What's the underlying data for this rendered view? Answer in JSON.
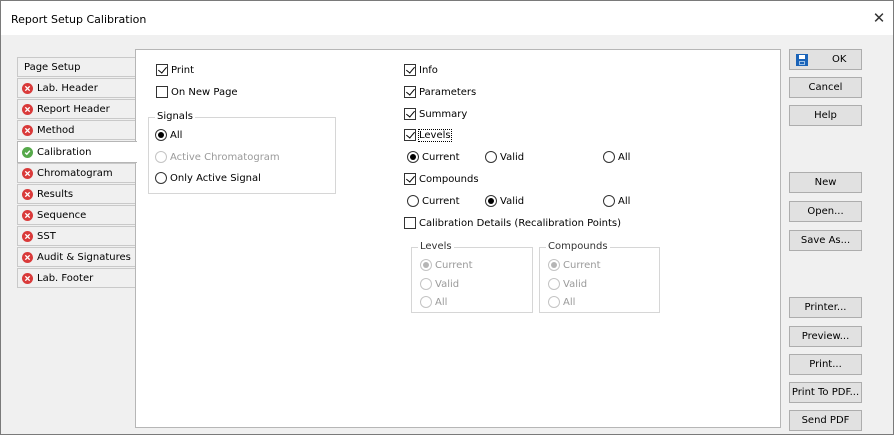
{
  "window": {
    "title": "Report Setup Calibration",
    "close_glyph": "✕"
  },
  "tabs": [
    {
      "label": "Page Setup",
      "icon": "none"
    },
    {
      "label": "Lab. Header",
      "icon": "error-icon"
    },
    {
      "label": "Report Header",
      "icon": "error-icon"
    },
    {
      "label": "Method",
      "icon": "error-icon"
    },
    {
      "label": "Calibration",
      "icon": "check-icon",
      "active": true
    },
    {
      "label": "Chromatogram",
      "icon": "error-icon"
    },
    {
      "label": "Results",
      "icon": "error-icon"
    },
    {
      "label": "Sequence",
      "icon": "error-icon"
    },
    {
      "label": "SST",
      "icon": "error-icon"
    },
    {
      "label": "Audit & Signatures",
      "icon": "error-icon"
    },
    {
      "label": "Lab. Footer",
      "icon": "error-icon"
    }
  ],
  "left": {
    "print": {
      "label": "Print",
      "checked": true
    },
    "on_new_page": {
      "label": "On New Page",
      "checked": false
    },
    "signals": {
      "label": "Signals",
      "all": "All",
      "active_chromatogram": "Active Chromatogram",
      "only_active_signal": "Only Active Signal",
      "selected": "All"
    }
  },
  "right": {
    "info": {
      "label": "Info",
      "checked": true
    },
    "parameters": {
      "label": "Parameters",
      "checked": true
    },
    "summary": {
      "label": "Summary",
      "checked": true
    },
    "levels": {
      "label": "Levels",
      "checked": true
    },
    "levels_options": {
      "current": "Current",
      "valid": "Valid",
      "all": "All",
      "selected": "Current"
    },
    "compounds": {
      "label": "Compounds",
      "checked": true
    },
    "compounds_options": {
      "current": "Current",
      "valid": "Valid",
      "all": "All",
      "selected": "Valid"
    },
    "calibration_details": {
      "label": "Calibration Details (Recalibration Points)",
      "checked": false
    },
    "details_levels": {
      "label": "Levels",
      "current": "Current",
      "valid": "Valid",
      "all": "All",
      "selected": "Current"
    },
    "details_compounds": {
      "label": "Compounds",
      "current": "Current",
      "valid": "Valid",
      "all": "All",
      "selected": "Current"
    }
  },
  "buttons": {
    "ok": "OK",
    "cancel": "Cancel",
    "help": "Help",
    "new": "New",
    "open": "Open...",
    "save_as": "Save As...",
    "printer": "Printer...",
    "preview": "Preview...",
    "print": "Print...",
    "print_to_pdf": "Print To PDF...",
    "send_pdf": "Send PDF"
  },
  "colors": {
    "error": "#d93a3a",
    "ok": "#56a94a",
    "accent": "#1a63b8"
  }
}
